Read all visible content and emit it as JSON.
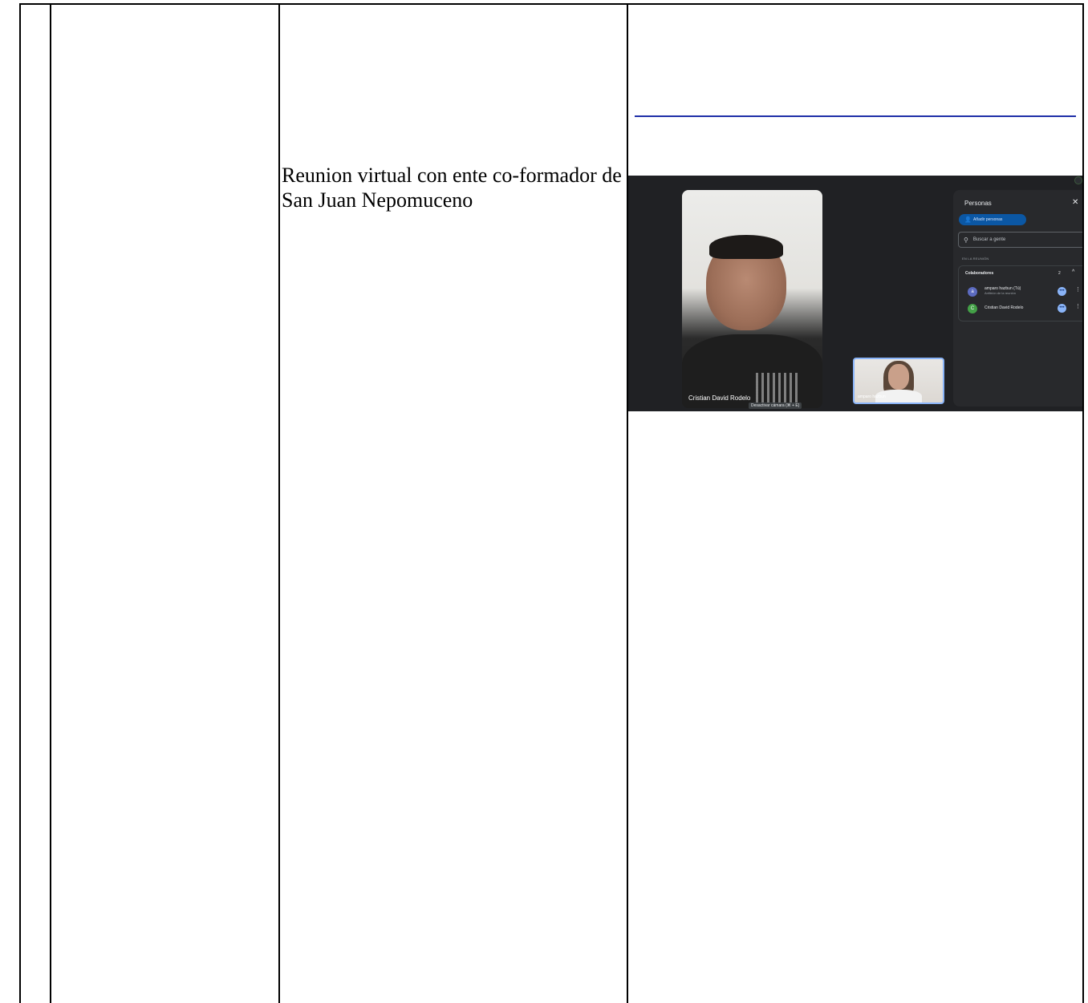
{
  "cell_text": "Reunion virtual con ente co-formador de San Juan Nepomuceno",
  "meet": {
    "main_tile_name": "Cristian David Rodelo",
    "camera_tooltip": "Desactivar cámara (⌘ + E)",
    "self_tile_name": "amparo hazbun",
    "panel": {
      "title": "Personas",
      "close_icon": "close-icon",
      "add_button": "Añadir personas",
      "search_placeholder": "Buscar a gente",
      "section_label": "EN LA REUNIÓN",
      "group_title": "Colaboradores",
      "group_count": "2",
      "participants": [
        {
          "initial": "a",
          "name": "amparo hazbun (Tú)",
          "subtitle": "Anfitrión de la reunión",
          "color": "#5c6bc0"
        },
        {
          "initial": "C",
          "name": "Cristian David Rodelo",
          "subtitle": "",
          "color": "#43a047"
        }
      ]
    }
  },
  "colors": {
    "rule": "#1f2fa8",
    "meet_bg": "#202124",
    "panel_bg": "#28292c",
    "accent": "#8ab4f8"
  }
}
